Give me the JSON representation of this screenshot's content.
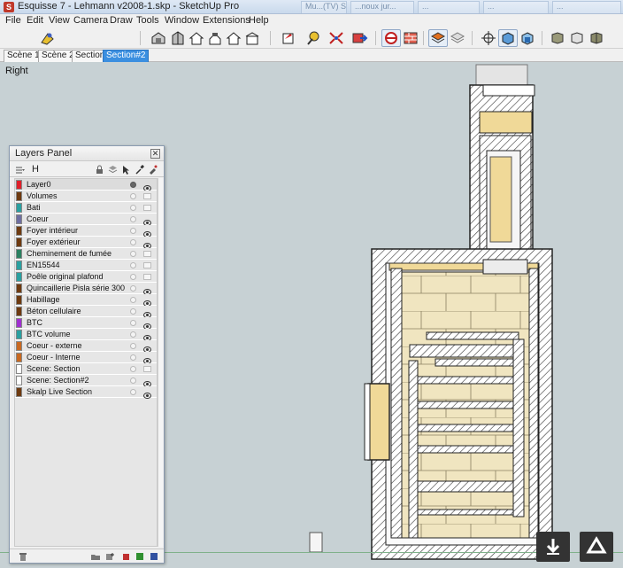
{
  "window": {
    "title": "Esquisse 7 - Lehmann v2008-1.skp - SketchUp Pro",
    "background_tabs": [
      "Mu...(TV) Semain...",
      "...noux jur...",
      "...",
      "...",
      "..."
    ]
  },
  "menu": [
    "File",
    "Edit",
    "View",
    "Camera",
    "Draw",
    "Tools",
    "Window",
    "Extensions",
    "Help"
  ],
  "scenes": [
    "Scène 1",
    "Scène 2",
    "Section",
    "Section#2"
  ],
  "viewport": {
    "view_name": "Right"
  },
  "layers_panel": {
    "title": "Layers Panel",
    "header_name_label": "H",
    "layers": [
      {
        "name": "Layer0",
        "color": "#e0202a",
        "current": true,
        "visible": true
      },
      {
        "name": "Volumes",
        "color": "#6e3a10",
        "current": false,
        "visible": false
      },
      {
        "name": "Bati",
        "color": "#2aa0a0",
        "current": false,
        "visible": false
      },
      {
        "name": "Coeur",
        "color": "#6e6ea0",
        "current": false,
        "visible": true
      },
      {
        "name": "Foyer intérieur",
        "color": "#6e3a10",
        "current": false,
        "visible": true
      },
      {
        "name": "Foyer extérieur",
        "color": "#6e3a10",
        "current": false,
        "visible": true
      },
      {
        "name": "Cheminement de fumée",
        "color": "#2a8060",
        "current": false,
        "visible": false
      },
      {
        "name": "EN15544",
        "color": "#2aa0a0",
        "current": false,
        "visible": false
      },
      {
        "name": "Poêle original plafond",
        "color": "#2aa0a0",
        "current": false,
        "visible": false
      },
      {
        "name": "Quincaillerie Pisla série 300",
        "color": "#6e3a10",
        "current": false,
        "visible": true
      },
      {
        "name": "Habillage",
        "color": "#6e3a10",
        "current": false,
        "visible": true
      },
      {
        "name": "Béton cellulaire",
        "color": "#6e3a10",
        "current": false,
        "visible": true
      },
      {
        "name": "BTC",
        "color": "#a030d0",
        "current": false,
        "visible": true
      },
      {
        "name": "BTC volume",
        "color": "#2aa0a0",
        "current": false,
        "visible": true
      },
      {
        "name": "Coeur - externe",
        "color": "#c86820",
        "current": false,
        "visible": true
      },
      {
        "name": "Coeur - Interne",
        "color": "#c86820",
        "current": false,
        "visible": true
      },
      {
        "name": "Scene: Section",
        "color": "#ffffff",
        "current": false,
        "visible": false
      },
      {
        "name": "Scene: Section#2",
        "color": "#ffffff",
        "current": false,
        "visible": true
      },
      {
        "name": "Skalp Live Section",
        "color": "#6e3a10",
        "current": false,
        "visible": true
      }
    ]
  },
  "icons": {
    "toolbar": [
      "select-icon",
      "component-icon",
      "house-views-icon",
      "section-plane-icon",
      "tape-measure-icon",
      "zoom-extents-icon",
      "export-icon",
      "section-cut-icon",
      "texture-icon",
      "layers-icon",
      "styles-icon",
      "orbit-icon",
      "iso-view-icon",
      "front-view-icon",
      "xray-icon",
      "shadows-icon"
    ],
    "colors": {
      "accent": "#3b8fe0",
      "viewport_bg": "#c7d1d4",
      "fill_tan": "#f0e5c0"
    }
  }
}
